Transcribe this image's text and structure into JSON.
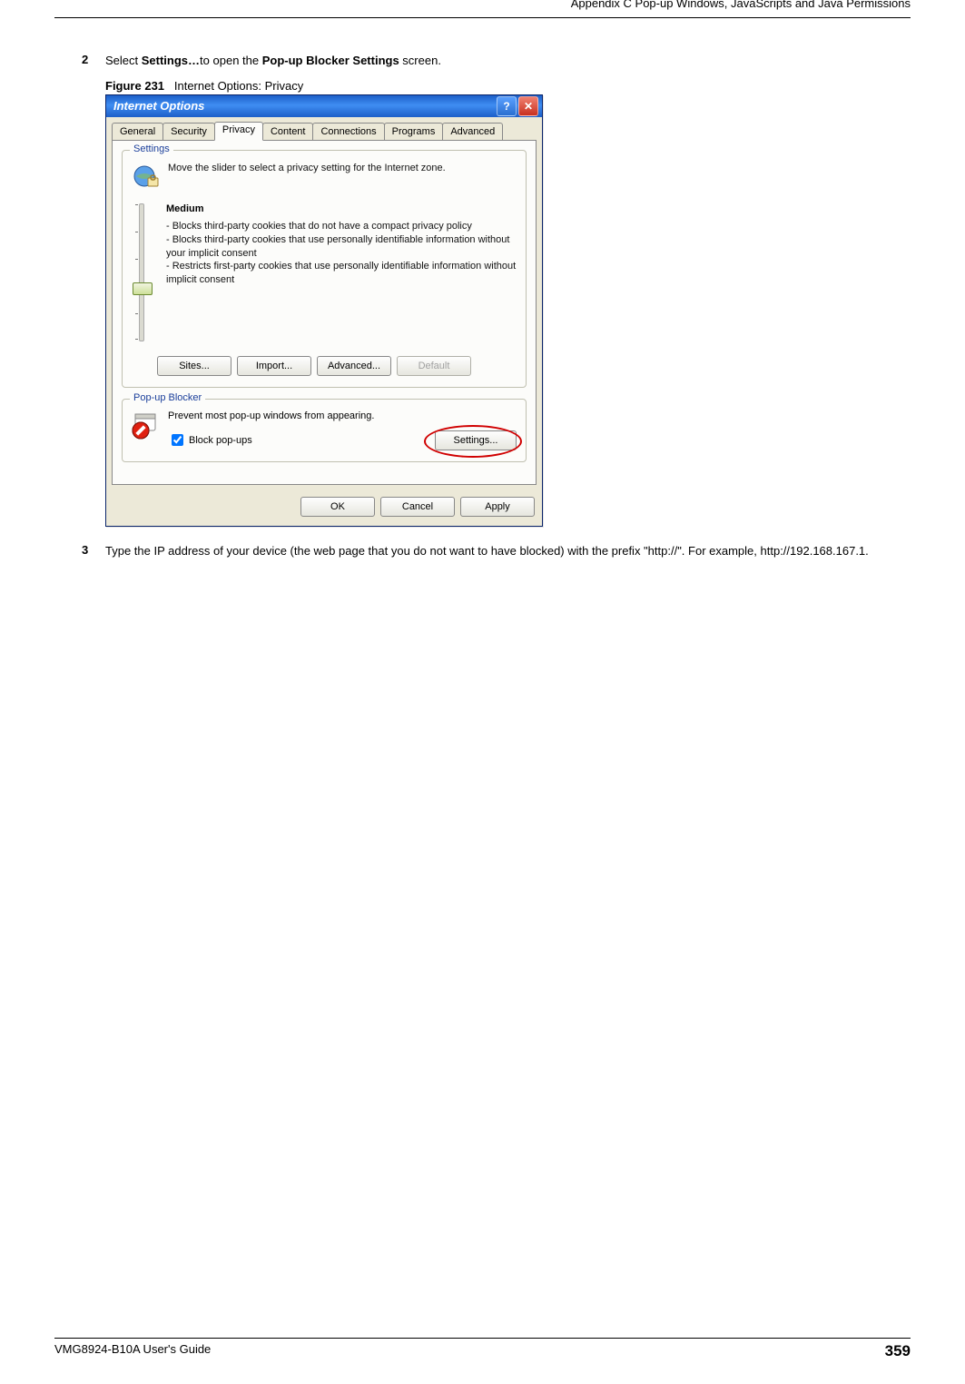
{
  "header": {
    "appendix": "Appendix C Pop-up Windows, JavaScripts and Java Permissions"
  },
  "steps": {
    "s2": {
      "num": "2",
      "pre": "Select ",
      "bold1": "Settings…",
      "mid": "to open the ",
      "bold2": "Pop-up Blocker Settings",
      "post": " screen."
    },
    "s3": {
      "num": "3",
      "text": "Type the IP address of your device (the web page that you do not want to have blocked) with the prefix \"http://\". For example, http://192.168.167.1."
    }
  },
  "figure": {
    "label": "Figure 231",
    "caption": "Internet Options: Privacy"
  },
  "dialog": {
    "title": "Internet Options",
    "help_glyph": "?",
    "close_glyph": "✕",
    "tabs": [
      "General",
      "Security",
      "Privacy",
      "Content",
      "Connections",
      "Programs",
      "Advanced"
    ],
    "settings_group": {
      "title": "Settings",
      "desc": "Move the slider to select a privacy setting for the Internet zone.",
      "level": "Medium",
      "bullets": [
        "- Blocks third-party cookies that do not have a compact privacy policy",
        "- Blocks third-party cookies that use personally identifiable information without your implicit consent",
        "- Restricts first-party cookies that use personally identifiable information without implicit consent"
      ],
      "buttons": {
        "sites": "Sites...",
        "import": "Import...",
        "advanced": "Advanced...",
        "default": "Default"
      }
    },
    "popup_group": {
      "title": "Pop-up Blocker",
      "desc": "Prevent most pop-up windows from appearing.",
      "checkbox": "Block pop-ups",
      "settings_btn": "Settings..."
    },
    "footer": {
      "ok": "OK",
      "cancel": "Cancel",
      "apply": "Apply"
    }
  },
  "footer": {
    "guide": "VMG8924-B10A User's Guide",
    "page": "359"
  }
}
